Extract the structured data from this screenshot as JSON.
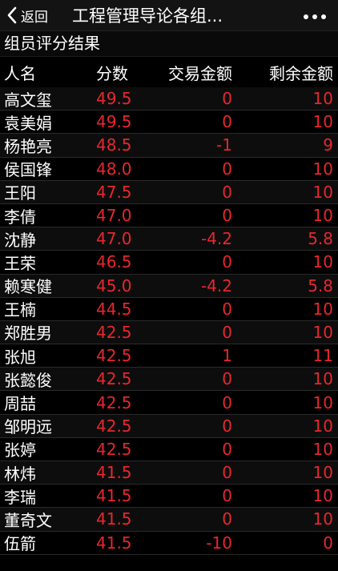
{
  "topbar": {
    "back_label": "返回",
    "title": "工程管理导论各组..."
  },
  "subtitle": "组员评分结果",
  "table": {
    "headers": [
      "人名",
      "分数",
      "交易金额",
      "剩余金额"
    ],
    "rows": [
      {
        "name": "高文玺",
        "score": "49.5",
        "trade": "0",
        "rest": "10"
      },
      {
        "name": "袁美娟",
        "score": "49.5",
        "trade": "0",
        "rest": "10"
      },
      {
        "name": "杨艳亮",
        "score": "48.5",
        "trade": "-1",
        "rest": "9"
      },
      {
        "name": "侯国锋",
        "score": "48.0",
        "trade": "0",
        "rest": "10"
      },
      {
        "name": "王阳",
        "score": "47.5",
        "trade": "0",
        "rest": "10"
      },
      {
        "name": "李倩",
        "score": "47.0",
        "trade": "0",
        "rest": "10"
      },
      {
        "name": "沈静",
        "score": "47.0",
        "trade": "-4.2",
        "rest": "5.8"
      },
      {
        "name": "王荣",
        "score": "46.5",
        "trade": "0",
        "rest": "10"
      },
      {
        "name": "赖寒健",
        "score": "45.0",
        "trade": "-4.2",
        "rest": "5.8"
      },
      {
        "name": "王楠",
        "score": "44.5",
        "trade": "0",
        "rest": "10"
      },
      {
        "name": "郑胜男",
        "score": "42.5",
        "trade": "0",
        "rest": "10"
      },
      {
        "name": "张旭",
        "score": "42.5",
        "trade": "1",
        "rest": "11"
      },
      {
        "name": "张懿俊",
        "score": "42.5",
        "trade": "0",
        "rest": "10"
      },
      {
        "name": "周喆",
        "score": "42.5",
        "trade": "0",
        "rest": "10"
      },
      {
        "name": "邹明远",
        "score": "42.5",
        "trade": "0",
        "rest": "10"
      },
      {
        "name": "张婷",
        "score": "42.5",
        "trade": "0",
        "rest": "10"
      },
      {
        "name": "林炜",
        "score": "41.5",
        "trade": "0",
        "rest": "10"
      },
      {
        "name": "李瑞",
        "score": "41.5",
        "trade": "0",
        "rest": "10"
      },
      {
        "name": "董奇文",
        "score": "41.5",
        "trade": "0",
        "rest": "10"
      },
      {
        "name": "伍箭",
        "score": "41.5",
        "trade": "-10",
        "rest": "0"
      }
    ]
  },
  "icons": {
    "back": "chevron-left-icon",
    "more": "more-dots-icon"
  },
  "colors": {
    "value_red": "#e8262d",
    "background": "#000000",
    "text": "#ffffff"
  }
}
